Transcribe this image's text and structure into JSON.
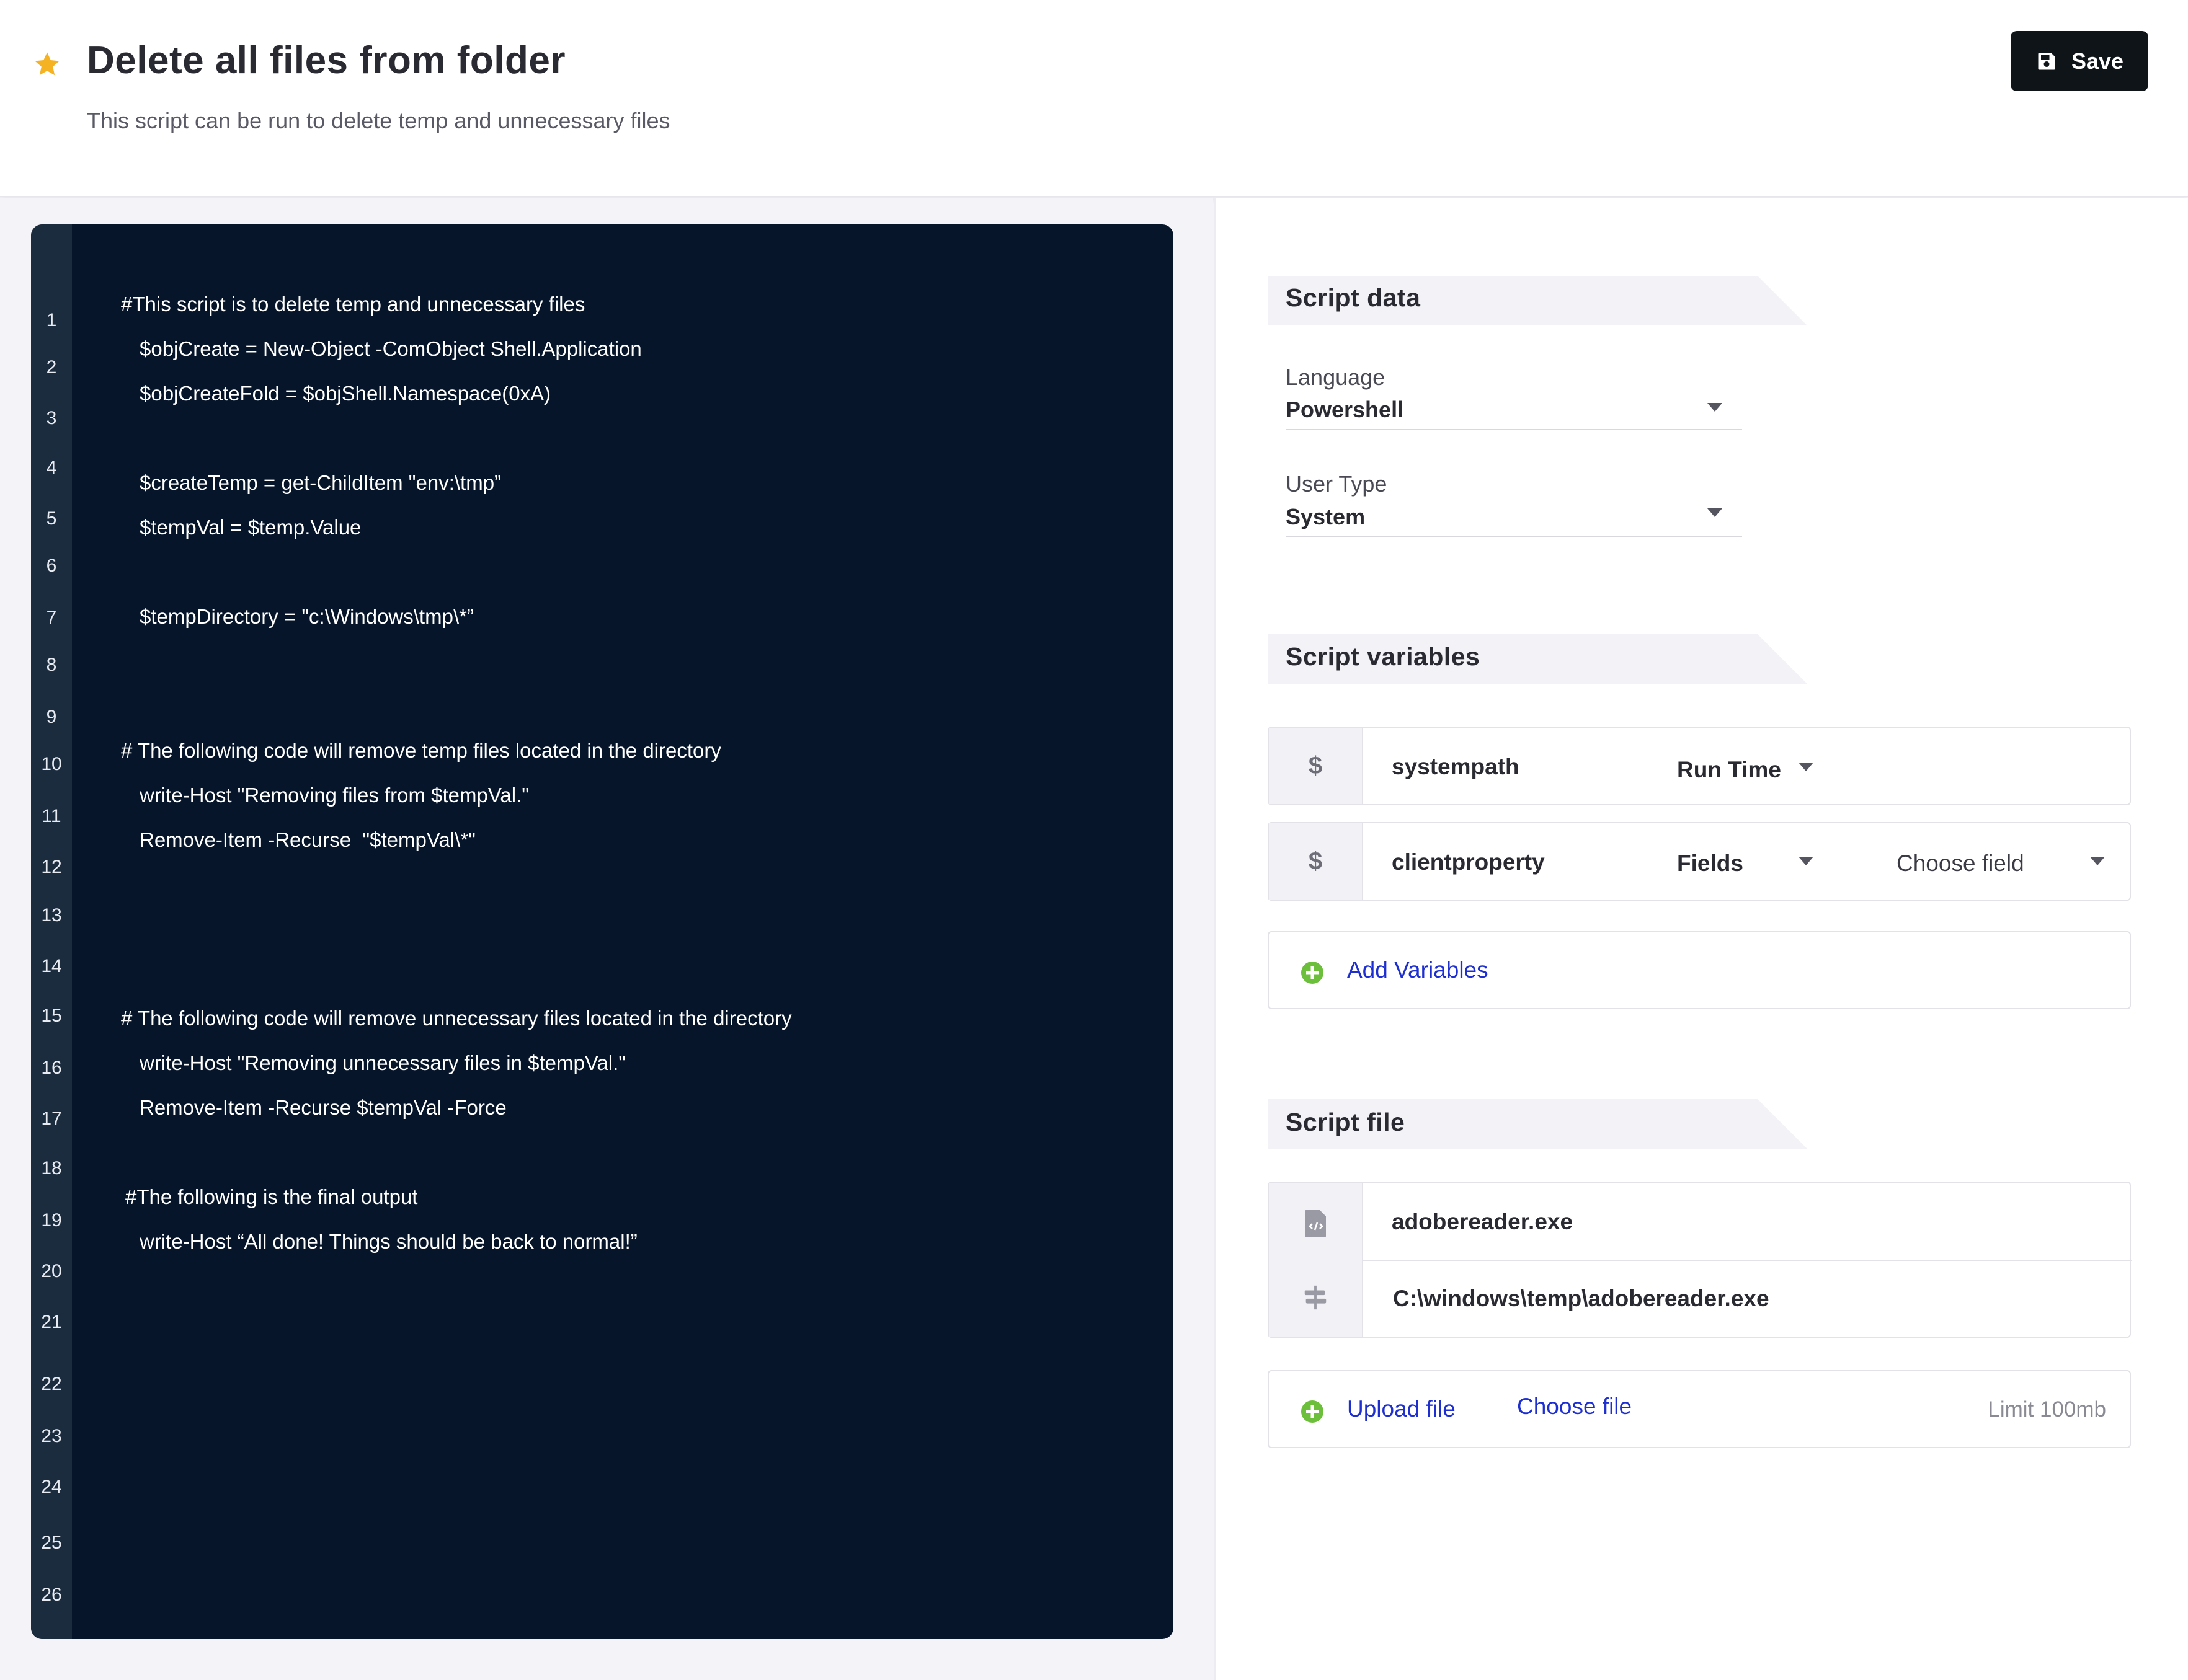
{
  "header": {
    "title": "Delete all files from folder",
    "subtitle": "This script can be run to delete temp and unnecessary files",
    "save_label": "Save"
  },
  "editor": {
    "line_numbers": [
      "1",
      "2",
      "3",
      "4",
      "5",
      "6",
      "7",
      "8",
      "9",
      "10",
      "11",
      "12",
      "13",
      "14",
      "15",
      "16",
      "17",
      "18",
      "19",
      "20",
      "21",
      "22",
      "23",
      "24",
      "25",
      "26"
    ],
    "lines": [
      "#This script is to delete temp and unnecessary files",
      "$objCreate = New-Object -ComObject Shell.Application",
      "$objCreateFold = $objShell.Namespace(0xA)",
      "$createTemp = get-ChildItem \"env:\\tmp”",
      "$tempVal = $temp.Value",
      "$tempDirectory = \"c:\\Windows\\tmp\\*”",
      "# The following code will remove temp files located in the directory",
      "write-Host \"Removing files from $tempVal.\"",
      "Remove-Item -Recurse  \"$tempVal\\*\"",
      "# The following code will remove unnecessary files located in the directory",
      "write-Host \"Removing unnecessary files in $tempVal.\"",
      "Remove-Item -Recurse $tempVal -Force",
      "#The following is the final output",
      "write-Host “All done! Things should be back to normal!”"
    ]
  },
  "script_data": {
    "section_title": "Script  data",
    "language_label": "Language",
    "language_value": "Powershell",
    "user_type_label": "User Type",
    "user_type_value": "System"
  },
  "script_variables": {
    "section_title": "Script variables",
    "variables": [
      {
        "prefix": "$",
        "name": "systempath",
        "type": "Run Time"
      },
      {
        "prefix": "$",
        "name": "clientproperty",
        "type": "Fields",
        "field_placeholder": "Choose field"
      }
    ],
    "add_label": "Add Variables"
  },
  "script_file": {
    "section_title": "Script file",
    "file_name": "adobereader.exe",
    "file_path": "C:\\windows\\temp\\adobereader.exe",
    "upload_label": "Upload file",
    "choose_label": "Choose file",
    "limit_label": "Limit 100mb"
  },
  "colors": {
    "accent_star": "#f5b324",
    "editor_bg": "#06152a",
    "gutter_bg": "#1c2c3f",
    "link": "#1d2fd0",
    "add_green": "#6cbf3a",
    "save_bg": "#0f1419"
  },
  "icons": {
    "star": "star-icon",
    "save": "floppy-disk-icon",
    "caret": "caret-down-icon",
    "plus": "plus-circle-icon",
    "file": "code-file-icon",
    "path": "signpost-icon"
  }
}
